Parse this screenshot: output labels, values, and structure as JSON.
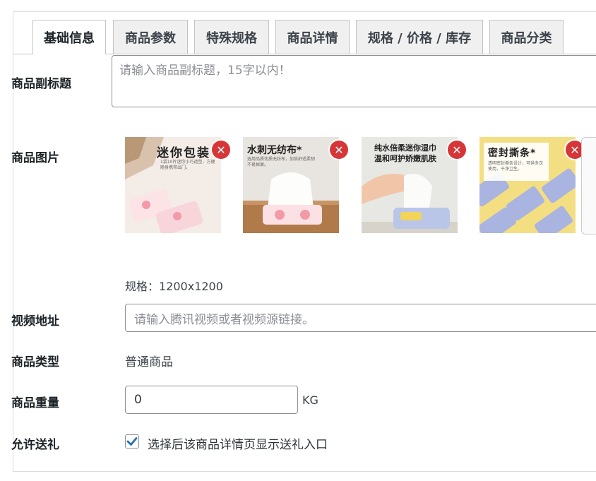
{
  "tabs": [
    "基础信息",
    "商品参数",
    "特殊规格",
    "商品详情",
    "规格 / 价格 / 库存",
    "商品分类"
  ],
  "subtitle": {
    "label": "商品副标题",
    "placeholder": "请输入商品副标题，15字以内！"
  },
  "images": {
    "label": "商品图片",
    "spec": "规格：1200x1200",
    "items": [
      {
        "title": "迷你包装",
        "sub": "1袋10片迷你小巧造型，方便随身携带出门。",
        "delete_icon": "close-icon"
      },
      {
        "title": "水刺无纺布*",
        "sub": "选用品质优质无纺布，加倍舒适柔韧不易掉屑。",
        "delete_icon": "close-icon"
      },
      {
        "title": "纯水倍柔迷你湿巾\n温和呵护娇嫩肌肤",
        "sub": "",
        "delete_icon": "close-icon"
      },
      {
        "title": "密封撕条*",
        "sub": "透明密封撕条设计，可供多次使用，干净卫生。",
        "delete_icon": "close-icon"
      }
    ]
  },
  "video": {
    "label": "视频地址",
    "placeholder": "请输入腾讯视频或者视频源链接。"
  },
  "type": {
    "label": "商品类型",
    "value": "普通商品"
  },
  "weight": {
    "label": "商品重量",
    "value": "0",
    "unit": "KG"
  },
  "gift": {
    "label": "允许送礼",
    "checked": true,
    "text": "选择后该商品详情页显示送礼入口"
  },
  "colors": {
    "accent": "#2271b1",
    "delete": "#d63638"
  }
}
